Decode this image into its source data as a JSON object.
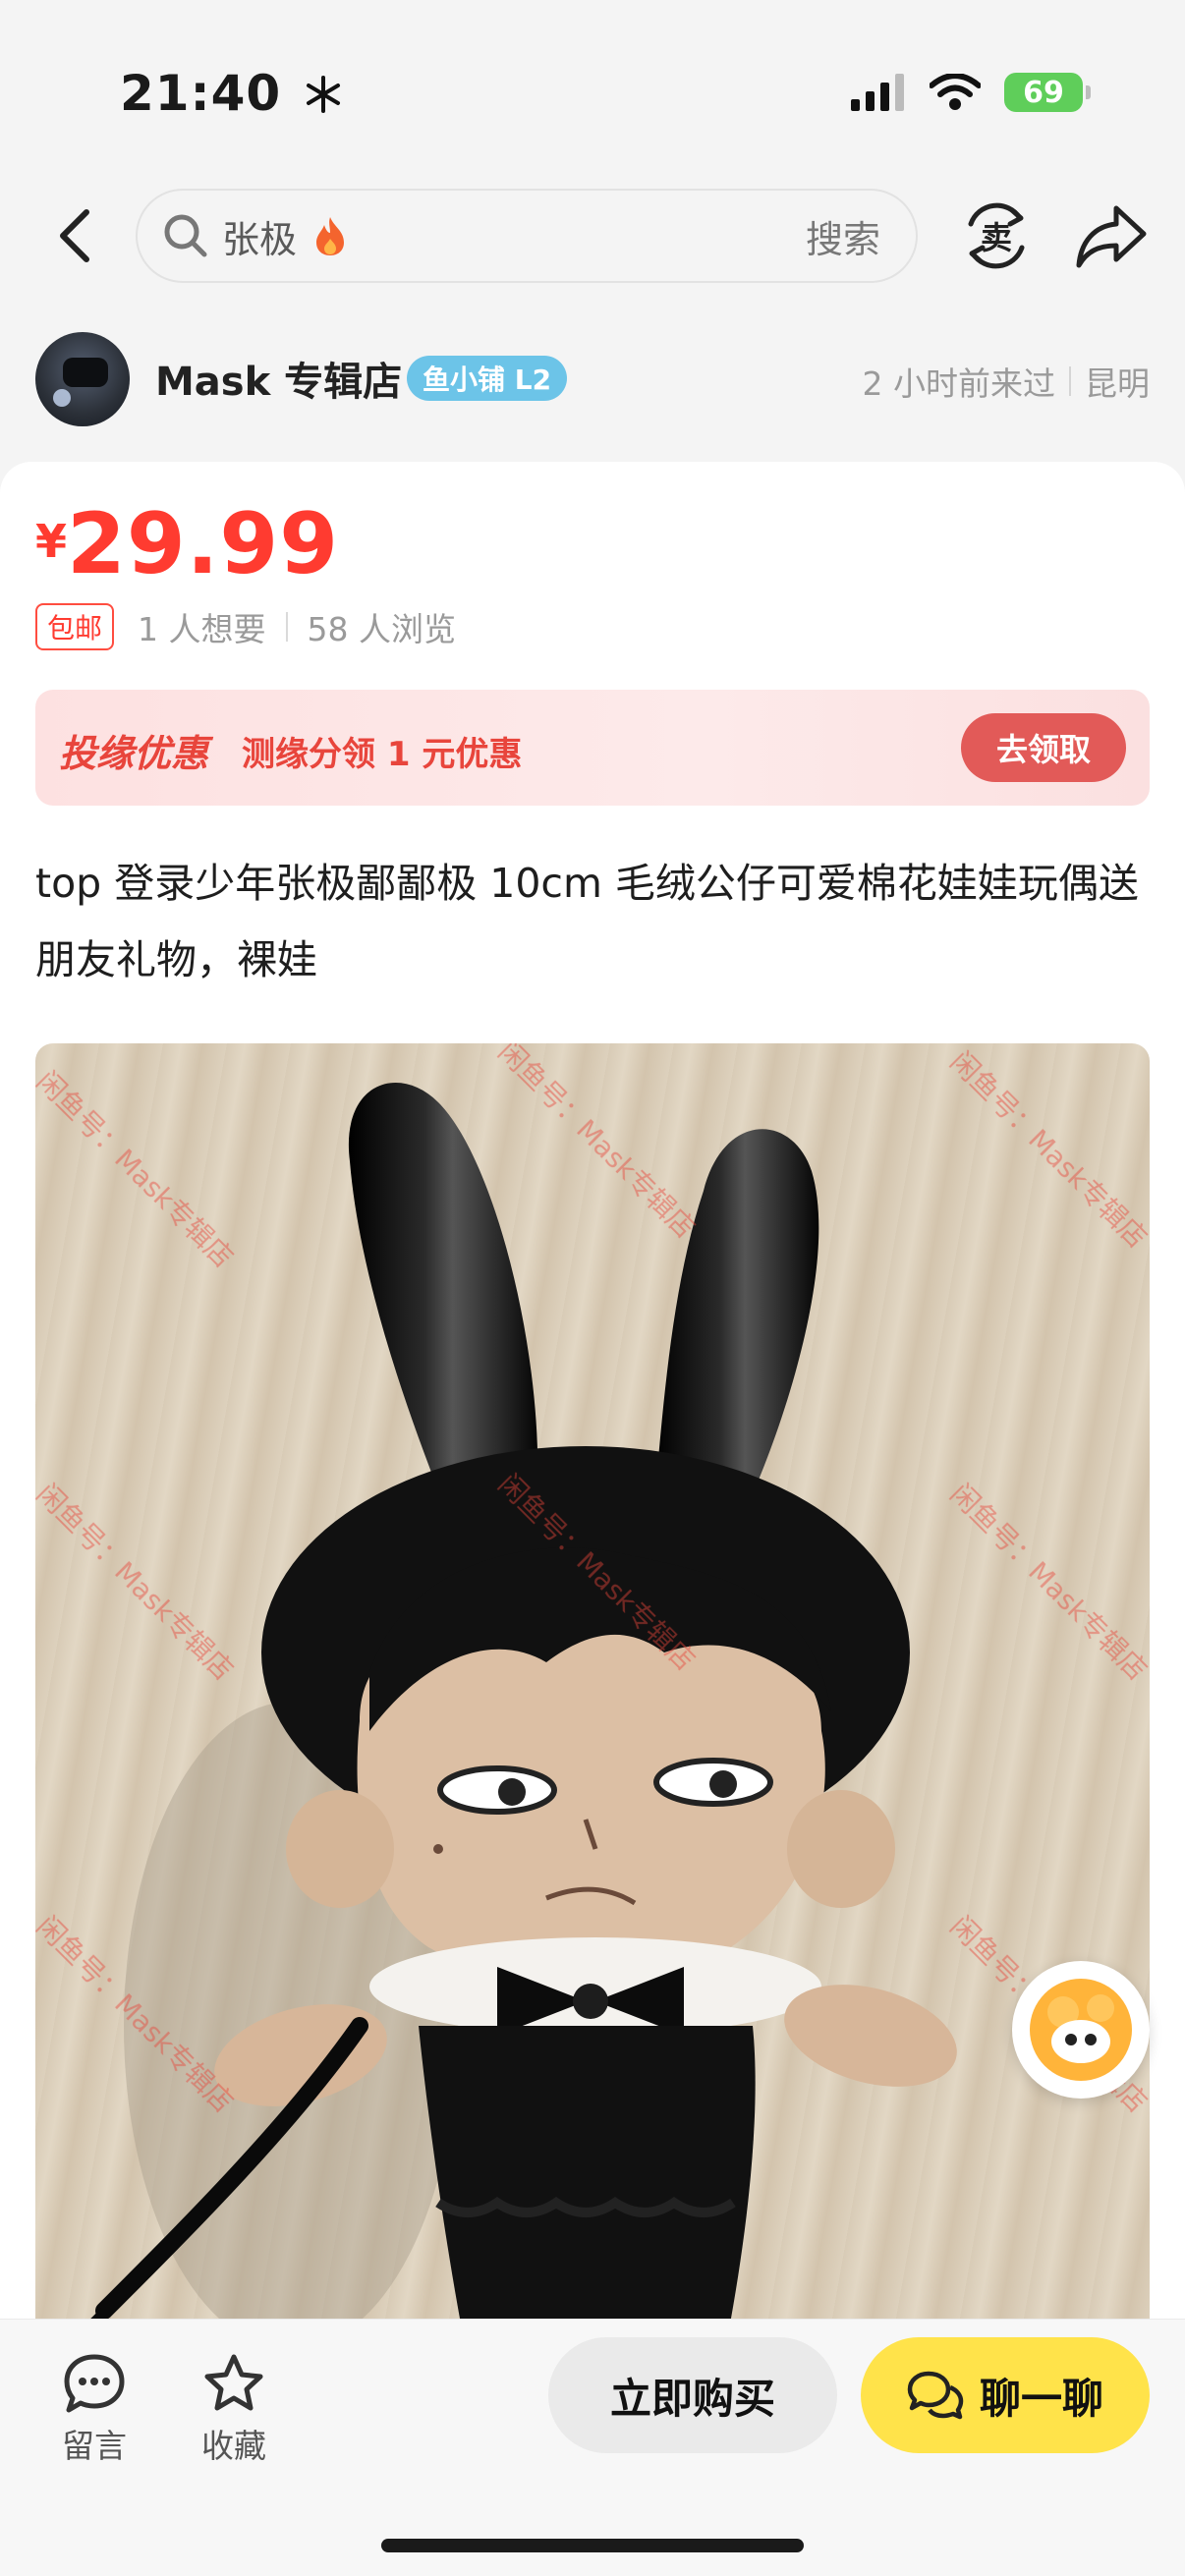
{
  "status": {
    "time": "21:40",
    "battery": "69"
  },
  "nav": {
    "search_text": "张极",
    "search_button": "搜索",
    "sell_icon_text": "卖"
  },
  "seller": {
    "name": "Mask 专辑店",
    "badge": "鱼小铺 L2",
    "last_seen": "2 小时前来过",
    "location": "昆明"
  },
  "product": {
    "price_currency": "¥",
    "price": "29.99",
    "free_shipping": "包邮",
    "wants": "1 人想要",
    "views": "58 人浏览",
    "title": "top 登录少年张极鄙鄙极 10cm 毛绒公仔可爱棉花娃娃玩偶送朋友礼物，裸娃",
    "watermark": "闲鱼号：Mask专辑店"
  },
  "promo": {
    "tag": "投缘优惠",
    "text": "测缘分领 1 元优惠",
    "button": "去领取"
  },
  "bottom": {
    "comment_label": "留言",
    "favorite_label": "收藏",
    "buy_label": "立即购买",
    "chat_label": "聊一聊"
  },
  "colors": {
    "price_red": "#ff3b30",
    "chat_yellow": "#ffe34a",
    "badge_blue": "#6cc4e8",
    "battery_green": "#5fce5a"
  }
}
